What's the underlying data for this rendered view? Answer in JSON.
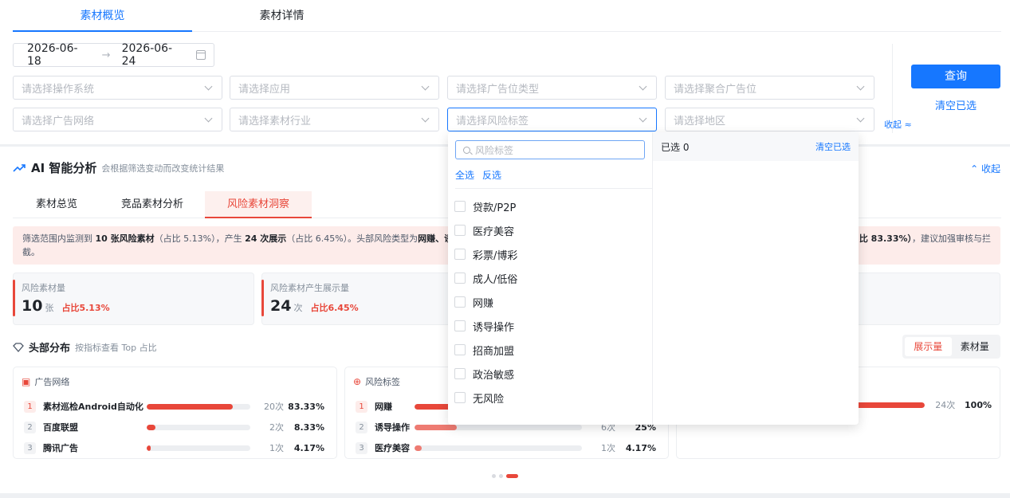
{
  "tabs": [
    {
      "label": "素材概览",
      "active": true
    },
    {
      "label": "素材详情",
      "active": false
    }
  ],
  "date_range": {
    "start": "2026-06-18",
    "end": "2026-06-24",
    "separator": "→"
  },
  "filters": {
    "os": "请选择操作系统",
    "app": "请选择应用",
    "ad_slot_type": "请选择广告位类型",
    "agg_ad_slot": "请选择聚合广告位",
    "ad_network": "请选择广告网络",
    "industry": "请选择素材行业",
    "risk_tag": "请选择风险标签",
    "region": "请选择地区"
  },
  "actions": {
    "query": "查询",
    "clear": "清空已选",
    "collapse": "收起 ≈"
  },
  "ai": {
    "title": "AI 智能分析",
    "subtitle": "会根据筛选变动而改变统计结果",
    "collapse": "收起",
    "tabs": [
      "素材总览",
      "竞品素材分析",
      "风险素材洞察"
    ],
    "alert": {
      "p1": "筛选范围内监测到 ",
      "b1": "10 张风险素材",
      "p2": "（占比 5.13%），产生 ",
      "b2": "24 次展示",
      "p3": "（占比 6.45%）。头部风险类型为",
      "b3": "网赚、诱",
      "tail_bold": "比 83.33%）",
      "tail": "，建议加强审核与拦",
      "line2": "截。"
    },
    "stats": [
      {
        "label": "风险素材量",
        "value": "10",
        "unit": "张",
        "pct": "占比5.13%"
      },
      {
        "label": "风险素材产生展示量",
        "value": "24",
        "unit": "次",
        "pct": "占比6.45%"
      }
    ],
    "head": {
      "title": "头部分布",
      "subtitle": "按指标查看 Top 占比",
      "seg": [
        "展示量",
        "素材量"
      ]
    },
    "cards": [
      {
        "title": "广告网络",
        "rows": [
          {
            "rank": "1",
            "name": "素材巡检Android自动化",
            "share": 0.8333,
            "count": "20次",
            "pct": "83.33%"
          },
          {
            "rank": "2",
            "name": "百度联盟",
            "share": 0.0833,
            "count": "2次",
            "pct": "8.33%"
          },
          {
            "rank": "3",
            "name": "腾讯广告",
            "share": 0.0417,
            "count": "1次",
            "pct": "4.17%"
          }
        ]
      },
      {
        "title": "风险标签",
        "rows": [
          {
            "rank": "1",
            "name": "网赚",
            "share": 0.75,
            "count": "",
            "pct": ""
          },
          {
            "rank": "2",
            "name": "诱导操作",
            "share": 0.25,
            "count": "6次",
            "pct": "25%"
          },
          {
            "rank": "3",
            "name": "医疗美容",
            "share": 0.0417,
            "count": "1次",
            "pct": "4.17%"
          }
        ]
      },
      {
        "title": "",
        "rows": [
          {
            "rank": "",
            "name": "",
            "share": 1.0,
            "count": "24次",
            "pct": "100%"
          }
        ]
      }
    ]
  },
  "dropdown": {
    "search_placeholder": "风险标签",
    "select_all": "全选",
    "invert": "反选",
    "options": [
      "贷款/P2P",
      "医疗美容",
      "彩票/博彩",
      "成人/低俗",
      "网赚",
      "诱导操作",
      "招商加盟",
      "政治敏感",
      "无风险"
    ],
    "selected_label": "已选 0",
    "clear": "清空已选"
  },
  "colors": {
    "primary": "#1677ff",
    "danger": "#e8473a"
  }
}
